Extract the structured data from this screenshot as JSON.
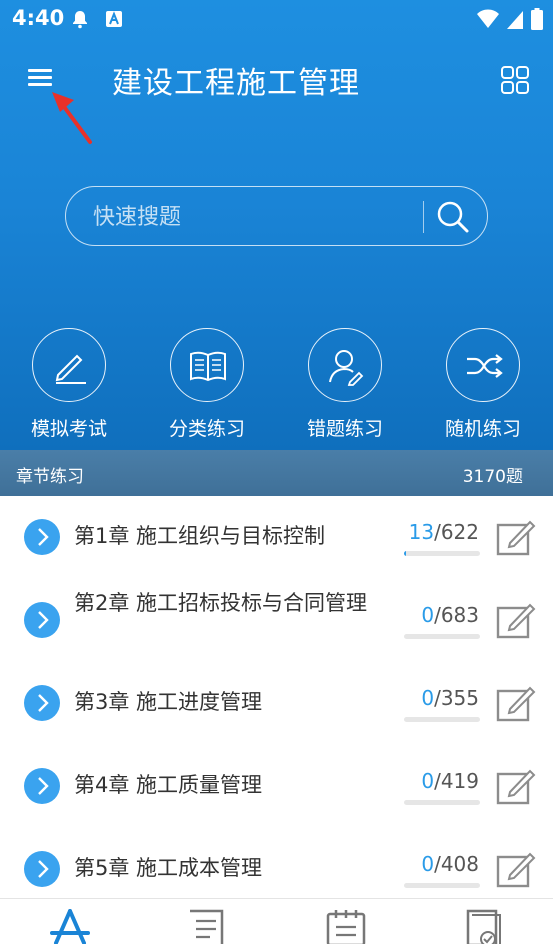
{
  "status": {
    "time": "4:40"
  },
  "header": {
    "title": "建设工程施工管理"
  },
  "search": {
    "placeholder": "快速搜题"
  },
  "actions": [
    {
      "label": "模拟考试",
      "icon": "pencil-icon"
    },
    {
      "label": "分类练习",
      "icon": "book-icon"
    },
    {
      "label": "错题练习",
      "icon": "user-edit-icon"
    },
    {
      "label": "随机练习",
      "icon": "shuffle-icon"
    }
  ],
  "section": {
    "title": "章节练习",
    "count": "3170题"
  },
  "chapters": [
    {
      "title": "第1章 施工组织与目标控制",
      "done": "13",
      "total": "/622",
      "progress": 0.021
    },
    {
      "title": "第2章 施工招标投标与合同管理",
      "done": "0",
      "total": "/683",
      "progress": 0
    },
    {
      "title": "第3章 施工进度管理",
      "done": "0",
      "total": "/355",
      "progress": 0
    },
    {
      "title": "第4章 施工质量管理",
      "done": "0",
      "total": "/419",
      "progress": 0
    },
    {
      "title": "第5章 施工成本管理",
      "done": "0",
      "total": "/408",
      "progress": 0
    }
  ],
  "colors": {
    "accent": "#2a9be8",
    "hero": "#1a84d6",
    "section_bar": "#4478a0",
    "chevron": "#3aa3ef",
    "annotation_arrow": "#e8312a"
  }
}
